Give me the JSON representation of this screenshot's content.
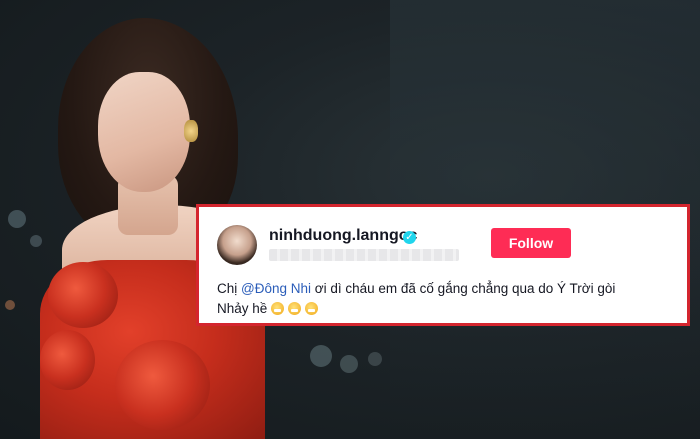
{
  "post": {
    "username": "ninhduong.lanngoc",
    "verified_icon": "verified-check-icon",
    "follow_label": "Follow",
    "comment": {
      "prefix": "Chị ",
      "mention": "@Đông Nhi",
      "text_rest": " ơi dì cháu em đã cố gắng chẳng qua do Ý Trời gòi",
      "line2": "Nhảy hề",
      "emoji_count": 3,
      "emoji_icon": "grinning-face-emoji"
    }
  },
  "colors": {
    "frame_border": "#d4252e",
    "follow_button": "#fe2c55",
    "mention": "#2b5db9",
    "verified": "#20d5ec"
  }
}
